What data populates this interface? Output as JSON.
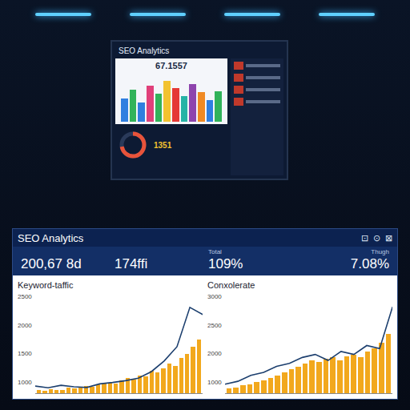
{
  "scene": {
    "monitor": {
      "title": "SEO Analytics",
      "figure": "67.1557",
      "donut": "1351",
      "donut_level": 0.72,
      "bars": [
        {
          "value": 45,
          "color": "#2f7fe0"
        },
        {
          "value": 62,
          "color": "#31b35a"
        },
        {
          "value": 38,
          "color": "#2f7fe0"
        },
        {
          "value": 70,
          "color": "#e0407a"
        },
        {
          "value": 55,
          "color": "#31b35a"
        },
        {
          "value": 80,
          "color": "#f2c230"
        },
        {
          "value": 66,
          "color": "#e53935"
        },
        {
          "value": 50,
          "color": "#26b3a6"
        },
        {
          "value": 74,
          "color": "#8e44ad"
        },
        {
          "value": 58,
          "color": "#f08a24"
        },
        {
          "value": 42,
          "color": "#2f7fe0"
        },
        {
          "value": 60,
          "color": "#31b35a"
        }
      ]
    }
  },
  "window": {
    "title": "SEO Analytics",
    "controls": [
      "⊡",
      "⊙",
      "⊠"
    ]
  },
  "stats": [
    {
      "value": "200,67 8d"
    },
    {
      "value": "174ffi"
    },
    {
      "label": "Total",
      "value": "109%"
    },
    {
      "label": "Thugh",
      "value": "7.08%"
    }
  ],
  "charts": [
    {
      "title": "Keyword-taffic",
      "ticks": [
        "2500",
        "2000",
        "1500",
        "1000"
      ],
      "bars": [
        80,
        60,
        120,
        100,
        90,
        150,
        130,
        170,
        200,
        180,
        240,
        260,
        300,
        280,
        350,
        420,
        380,
        500,
        460,
        620,
        580,
        700,
        820,
        760,
        980,
        1100,
        1300,
        1500
      ],
      "line": [
        200,
        150,
        220,
        180,
        160,
        260,
        300,
        350,
        420,
        600,
        900,
        1300,
        2400,
        2200
      ]
    },
    {
      "title": "Conxolerate",
      "ticks": [
        "3000",
        "2500",
        "2000",
        "1000"
      ],
      "bars": [
        150,
        200,
        260,
        300,
        380,
        420,
        520,
        600,
        700,
        820,
        900,
        1000,
        1100,
        1050,
        1150,
        1200,
        1100,
        1250,
        1300,
        1200,
        1400,
        1500,
        1700,
        2000
      ],
      "line": [
        300,
        400,
        600,
        700,
        900,
        1000,
        1200,
        1300,
        1100,
        1400,
        1300,
        1600,
        1500,
        2900
      ]
    }
  ]
}
